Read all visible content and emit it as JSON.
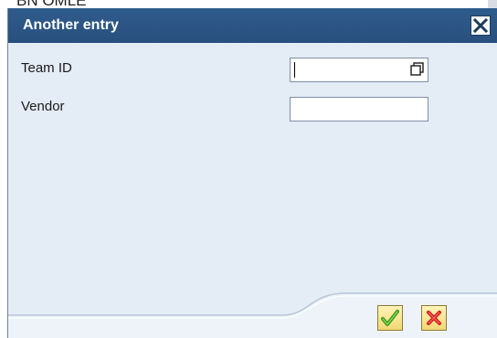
{
  "background": {
    "partial_text": "BN OMLE"
  },
  "dialog": {
    "title": "Another entry",
    "close_icon": "close-icon",
    "fields": [
      {
        "label": "Team ID",
        "value": "",
        "has_value_help": true,
        "value_help_icon": "value-help-icon"
      },
      {
        "label": "Vendor",
        "value": "",
        "has_value_help": false
      }
    ],
    "buttons": {
      "confirm_icon": "checkmark-icon",
      "cancel_icon": "cancel-x-icon"
    }
  },
  "colors": {
    "titlebar": "#2f5b8c",
    "dialog_body": "#e4ecf6",
    "confirm_check": "#3c9a1c",
    "cancel_x": "#d01818"
  }
}
